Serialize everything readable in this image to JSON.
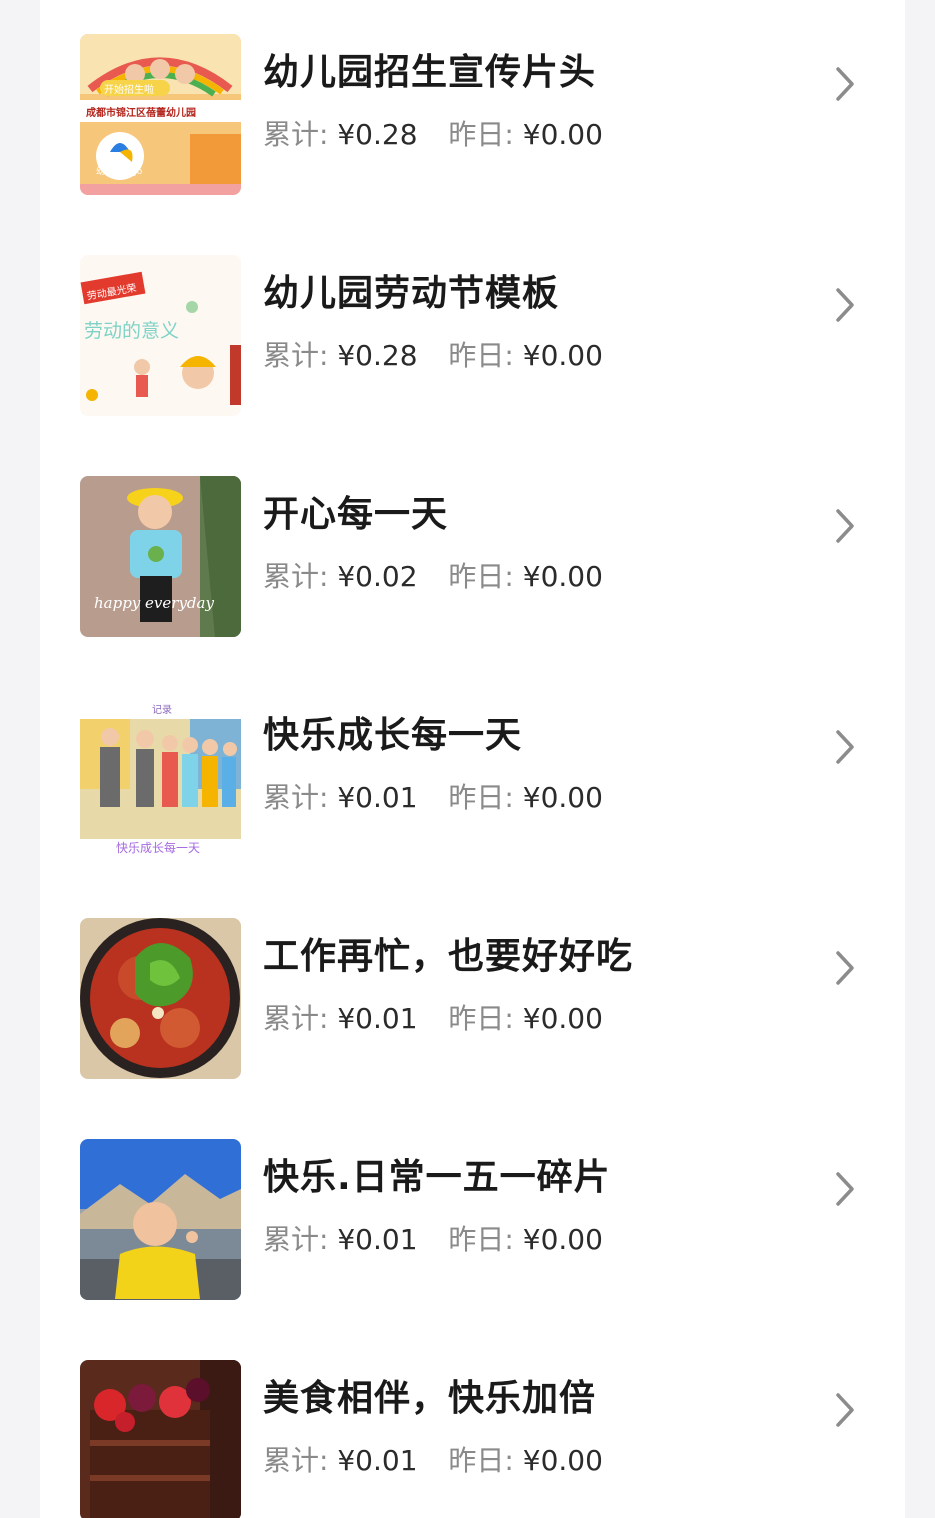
{
  "labels": {
    "total": "累计:",
    "yesterday": "昨日:"
  },
  "items": [
    {
      "title": "幼儿园招生宣传片头",
      "total": "¥0.28",
      "yesterday": "¥0.00",
      "thumb_icon": "kindergarten-enrollment-thumbnail",
      "thumb_text": [
        "开始招生啦",
        "成都市锦江区蓓蕾幼儿园",
        "幼儿园logo"
      ]
    },
    {
      "title": "幼儿园劳动节模板",
      "total": "¥0.28",
      "yesterday": "¥0.00",
      "thumb_icon": "labor-day-thumbnail",
      "thumb_text": [
        "劳动最光荣",
        "劳动的意义"
      ]
    },
    {
      "title": "开心每一天",
      "total": "¥0.02",
      "yesterday": "¥0.00",
      "thumb_icon": "child-outdoor-photo-thumbnail",
      "thumb_text": [
        "happy everyday"
      ]
    },
    {
      "title": "快乐成长每一天",
      "total": "¥0.01",
      "yesterday": "¥0.00",
      "thumb_icon": "children-group-photo-thumbnail",
      "thumb_text": [
        "记录",
        "快乐成长每一天"
      ]
    },
    {
      "title": "工作再忙，也要好好吃",
      "total": "¥0.01",
      "yesterday": "¥0.00",
      "thumb_icon": "spicy-dish-photo-thumbnail",
      "thumb_text": []
    },
    {
      "title": "快乐.日常一五一碎片",
      "total": "¥0.01",
      "yesterday": "¥0.00",
      "thumb_icon": "child-mountain-photo-thumbnail",
      "thumb_text": []
    },
    {
      "title": "美食相伴，快乐加倍",
      "total": "¥0.01",
      "yesterday": "¥0.00",
      "thumb_icon": "chocolate-cake-photo-thumbnail",
      "thumb_text": []
    }
  ],
  "colors": {
    "title": "#1a1a1a",
    "label": "#8a8a8a",
    "value": "#2b2b2b",
    "chevron": "#8c8c8c",
    "background": "#f4f4f6",
    "panel": "#ffffff"
  }
}
